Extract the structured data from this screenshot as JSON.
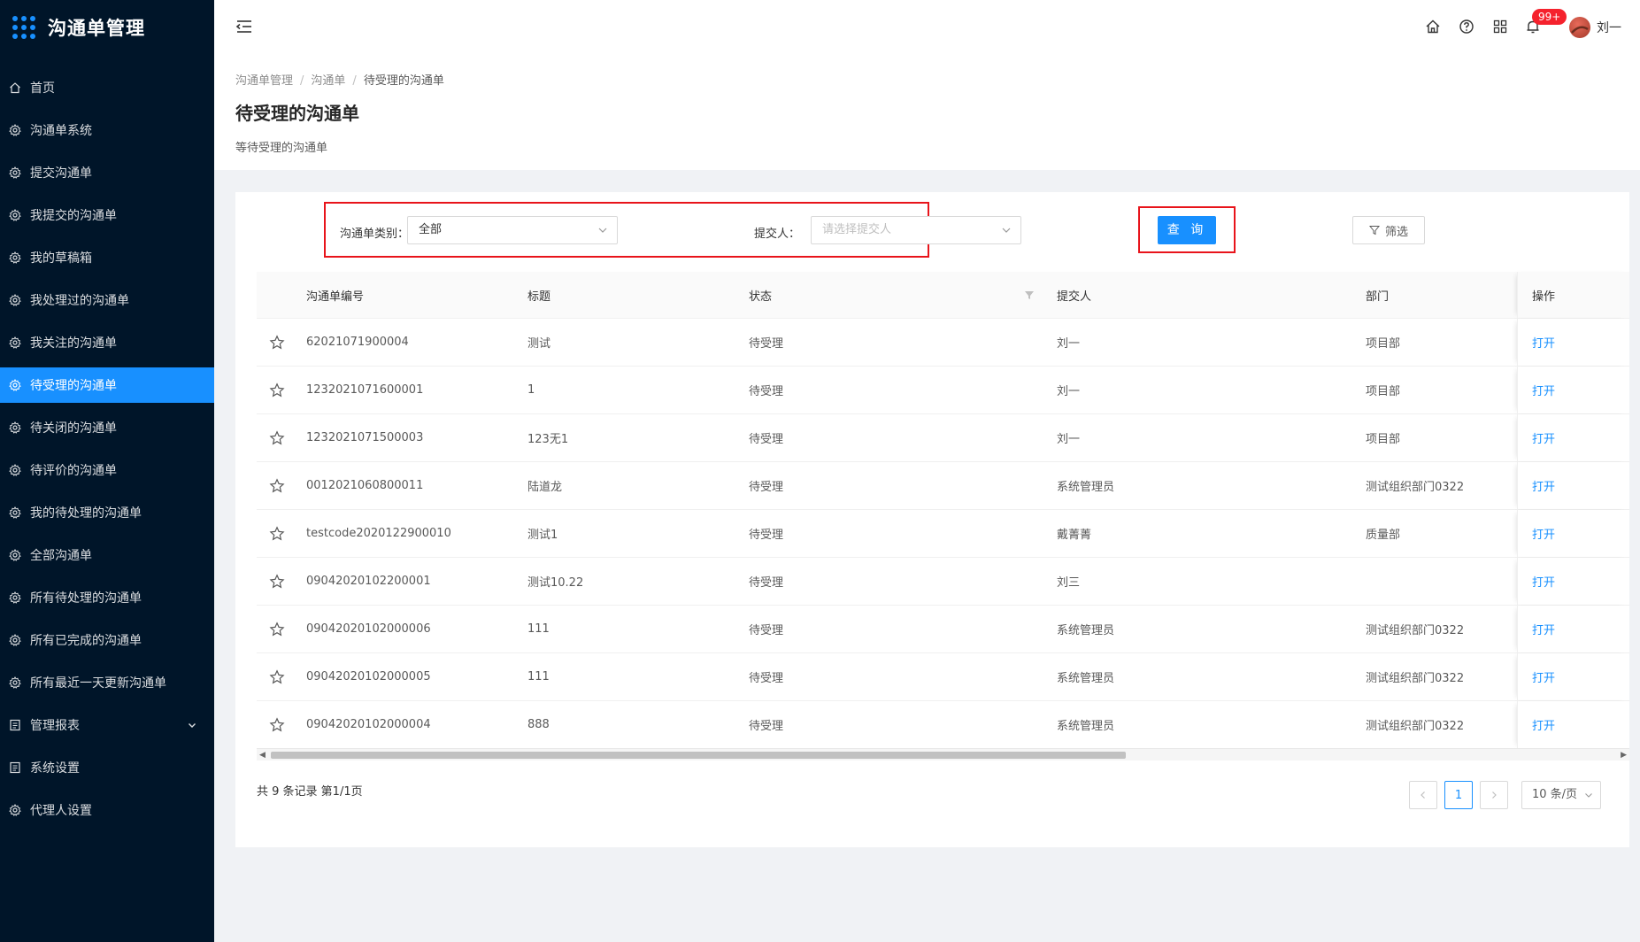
{
  "app": {
    "title": "沟通单管理"
  },
  "sidebar": {
    "items": [
      {
        "label": "首页",
        "icon": "home-icon"
      },
      {
        "label": "沟通单系统",
        "icon": "gear-icon"
      },
      {
        "label": "提交沟通单",
        "icon": "gear-icon"
      },
      {
        "label": "我提交的沟通单",
        "icon": "gear-icon"
      },
      {
        "label": "我的草稿箱",
        "icon": "gear-icon"
      },
      {
        "label": "我处理过的沟通单",
        "icon": "gear-icon"
      },
      {
        "label": "我关注的沟通单",
        "icon": "gear-icon"
      },
      {
        "label": "待受理的沟通单",
        "icon": "gear-icon",
        "active": true
      },
      {
        "label": "待关闭的沟通单",
        "icon": "gear-icon"
      },
      {
        "label": "待评价的沟通单",
        "icon": "gear-icon"
      },
      {
        "label": "我的待处理的沟通单",
        "icon": "gear-icon"
      },
      {
        "label": "全部沟通单",
        "icon": "gear-icon"
      },
      {
        "label": "所有待处理的沟通单",
        "icon": "gear-icon"
      },
      {
        "label": "所有已完成的沟通单",
        "icon": "gear-icon"
      },
      {
        "label": "所有最近一天更新沟通单",
        "icon": "gear-icon"
      },
      {
        "label": "管理报表",
        "icon": "report-icon",
        "expandable": true
      },
      {
        "label": "系统设置",
        "icon": "report-icon"
      },
      {
        "label": "代理人设置",
        "icon": "gear-icon"
      }
    ]
  },
  "header": {
    "badge": "99+",
    "user": "刘一"
  },
  "breadcrumb": [
    "沟通单管理",
    "沟通单",
    "待受理的沟通单"
  ],
  "page": {
    "title": "待受理的沟通单",
    "description": "等待受理的沟通单"
  },
  "filters": {
    "type_label": "沟通单类别：",
    "type_value": "全部",
    "submitter_label": "提交人：",
    "submitter_placeholder": "请选择提交人",
    "query_button": "查 询",
    "filter_button": "筛选"
  },
  "table": {
    "columns": [
      "沟通单编号",
      "标题",
      "状态",
      "提交人",
      "部门",
      "操作"
    ],
    "rows": [
      {
        "code": "62021071900004",
        "title": "测试",
        "status": "待受理",
        "submitter": "刘一",
        "dept": "项目部",
        "op": "打开"
      },
      {
        "code": "1232021071600001",
        "title": "1",
        "status": "待受理",
        "submitter": "刘一",
        "dept": "项目部",
        "op": "打开"
      },
      {
        "code": "1232021071500003",
        "title": "123无1",
        "status": "待受理",
        "submitter": "刘一",
        "dept": "项目部",
        "op": "打开"
      },
      {
        "code": "0012021060800011",
        "title": "陆道龙",
        "status": "待受理",
        "submitter": "系统管理员",
        "dept": "测试组织部门0322",
        "op": "打开"
      },
      {
        "code": "testcode2020122900010",
        "title": "测试1",
        "status": "待受理",
        "submitter": "戴菁菁",
        "dept": "质量部",
        "op": "打开"
      },
      {
        "code": "09042020102200001",
        "title": "测试10.22",
        "status": "待受理",
        "submitter": "刘三",
        "dept": "",
        "op": "打开"
      },
      {
        "code": "09042020102000006",
        "title": "111",
        "status": "待受理",
        "submitter": "系统管理员",
        "dept": "测试组织部门0322",
        "op": "打开"
      },
      {
        "code": "09042020102000005",
        "title": "111",
        "status": "待受理",
        "submitter": "系统管理员",
        "dept": "测试组织部门0322",
        "op": "打开"
      },
      {
        "code": "09042020102000004",
        "title": "888",
        "status": "待受理",
        "submitter": "系统管理员",
        "dept": "测试组织部门0322",
        "op": "打开"
      }
    ]
  },
  "pagination": {
    "total_text": "共 9 条记录 第1/1页",
    "current_page": "1",
    "page_size": "10 条/页"
  },
  "colors": {
    "sidebar_bg": "#001529",
    "primary": "#1890ff",
    "highlight_box": "#e8141b",
    "badge": "#f5222d"
  }
}
